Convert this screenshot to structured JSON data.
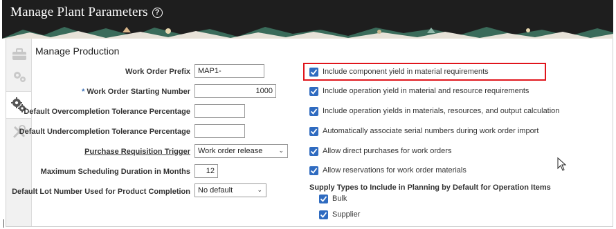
{
  "header": {
    "title": "Manage Plant Parameters",
    "help_icon": "?"
  },
  "section": {
    "title": "Manage Production"
  },
  "form": {
    "work_order_prefix": {
      "label": "Work Order Prefix",
      "value": "MAP1-"
    },
    "work_order_starting_number": {
      "required_mark": "*",
      "label": "Work Order Starting Number",
      "value": "1000"
    },
    "overcompletion_tolerance": {
      "label": "Default Overcompletion Tolerance Percentage",
      "value": ""
    },
    "undercompletion_tolerance": {
      "label": "Default Undercompletion Tolerance Percentage",
      "value": ""
    },
    "purchase_requisition_trigger": {
      "label": "Purchase Requisition Trigger",
      "value": "Work order release"
    },
    "max_scheduling_duration": {
      "label": "Maximum Scheduling Duration in Months",
      "value": "12"
    },
    "default_lot_number": {
      "label": "Default Lot Number Used for Product Completion",
      "value": "No default"
    }
  },
  "options": [
    {
      "label": "Include component yield in material requirements",
      "checked": true
    },
    {
      "label": "Include operation yield in material and resource requirements",
      "checked": true
    },
    {
      "label": "Include operation yields in materials, resources, and output calculation",
      "checked": true,
      "highlighted": true
    },
    {
      "label": "Automatically associate serial numbers during work order import",
      "checked": true
    },
    {
      "label": "Allow direct purchases for work orders",
      "checked": true
    },
    {
      "label": "Allow reservations for work order materials",
      "checked": true
    }
  ],
  "supply_types": {
    "heading": "Supply Types to Include in Planning by Default for Operation Items",
    "items": [
      {
        "label": "Bulk",
        "checked": true
      },
      {
        "label": "Supplier",
        "checked": true
      }
    ]
  },
  "colors": {
    "header_bg": "#1e1e1e",
    "checkbox": "#2f6bc0",
    "highlight_border": "#e0151c"
  },
  "rail_icons": [
    "briefcase-icon",
    "gears-small-icon",
    "gears-icon",
    "tools-icon"
  ]
}
